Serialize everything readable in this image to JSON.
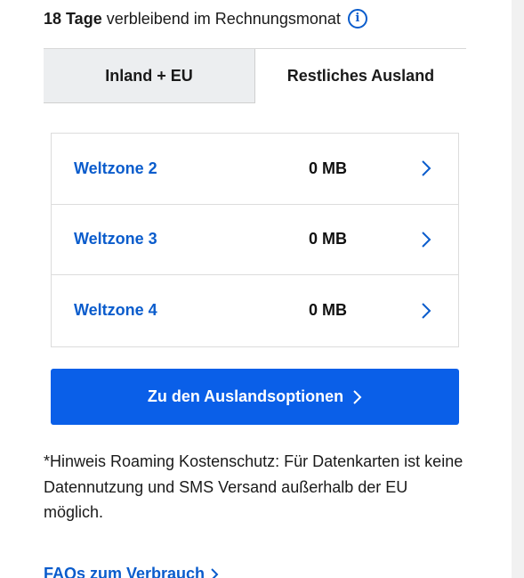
{
  "header": {
    "days_bold": "18 Tage",
    "days_text": "verbleibend im Rechnungsmonat",
    "info_icon": "info-icon"
  },
  "tabs": [
    {
      "label": "Inland + EU",
      "active": false
    },
    {
      "label": "Restliches Ausland",
      "active": true
    }
  ],
  "zones": [
    {
      "name": "Weltzone 2",
      "value": "0 MB"
    },
    {
      "name": "Weltzone 3",
      "value": "0 MB"
    },
    {
      "name": "Weltzone 4",
      "value": "0 MB"
    }
  ],
  "cta": {
    "label": "Zu den Auslandsoptionen"
  },
  "note": "*Hinweis Roaming Kostenschutz: Für Datenkarten ist keine Datennutzung und SMS Versand außerhalb der EU möglich.",
  "faq": {
    "label": "FAQs zum Verbrauch"
  },
  "colors": {
    "accent": "#0a5ccc",
    "button": "#0a5fe8",
    "tab_inactive": "#eceef0"
  }
}
